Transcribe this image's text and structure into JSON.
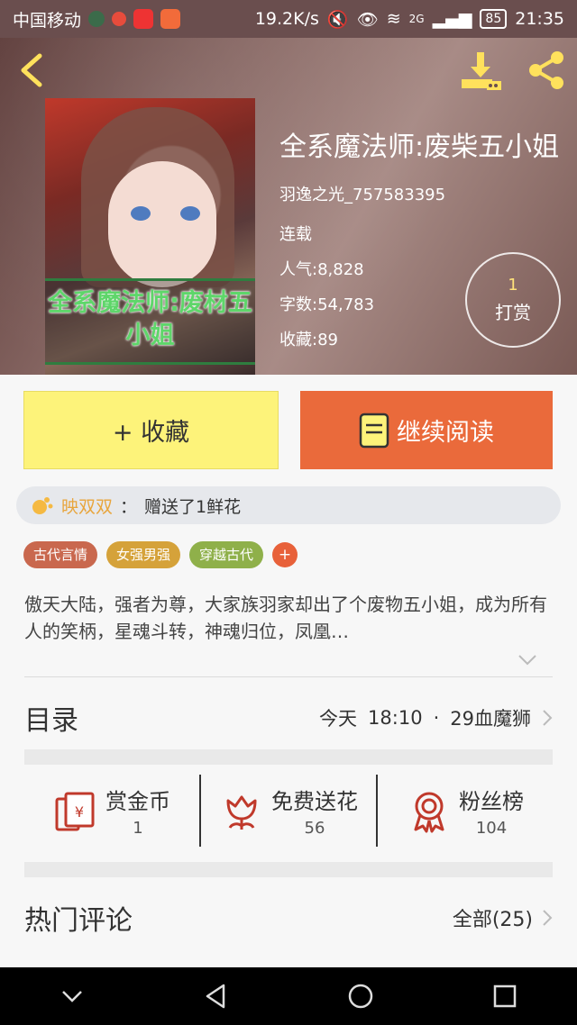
{
  "status_bar": {
    "carrier": "中国移动",
    "speed": "19.2K/s",
    "net": "2G",
    "battery": "85",
    "time": "21:35"
  },
  "book": {
    "title": "全系魔法师:废柴五小姐",
    "cover_title": "全系魔法师:废材五小姐",
    "author": "羽逸之光_757583395",
    "status": "连载",
    "popularity": "人气:8,828",
    "word_count": "字数:54,783",
    "favorites": "收藏:89"
  },
  "tip": {
    "count": "1",
    "label": "打赏"
  },
  "actions": {
    "favorite_label": "+ 收藏",
    "read_label": "继续阅读"
  },
  "gift_banner": {
    "name": "映双双",
    "separator": "：",
    "message": "赠送了1鲜花"
  },
  "tags": [
    {
      "label": "古代言情",
      "color": "#c9684e"
    },
    {
      "label": "女强男强",
      "color": "#d5a23a"
    },
    {
      "label": "穿越古代",
      "color": "#8fb04a"
    }
  ],
  "tag_add_label": "+",
  "description": "傲天大陆，强者为尊，大家族羽家却出了个废物五小姐，成为所有人的笑柄，星魂斗转，神魂归位，凤凰…",
  "toc": {
    "label": "目录",
    "day": "今天",
    "time": "18:10",
    "dot": "·",
    "latest": "29血魔狮"
  },
  "stats": [
    {
      "label": "赏金币",
      "value": "1",
      "icon": "coin-red-packet-icon"
    },
    {
      "label": "免费送花",
      "value": "56",
      "icon": "flower-icon"
    },
    {
      "label": "粉丝榜",
      "value": "104",
      "icon": "ribbon-badge-icon"
    }
  ],
  "hot_comments": {
    "label": "热门评论",
    "all_label": "全部(25)"
  },
  "colors": {
    "accent_orange": "#ea6a3b",
    "accent_yellow": "#fdf37a",
    "icon_red": "#c0392b"
  }
}
